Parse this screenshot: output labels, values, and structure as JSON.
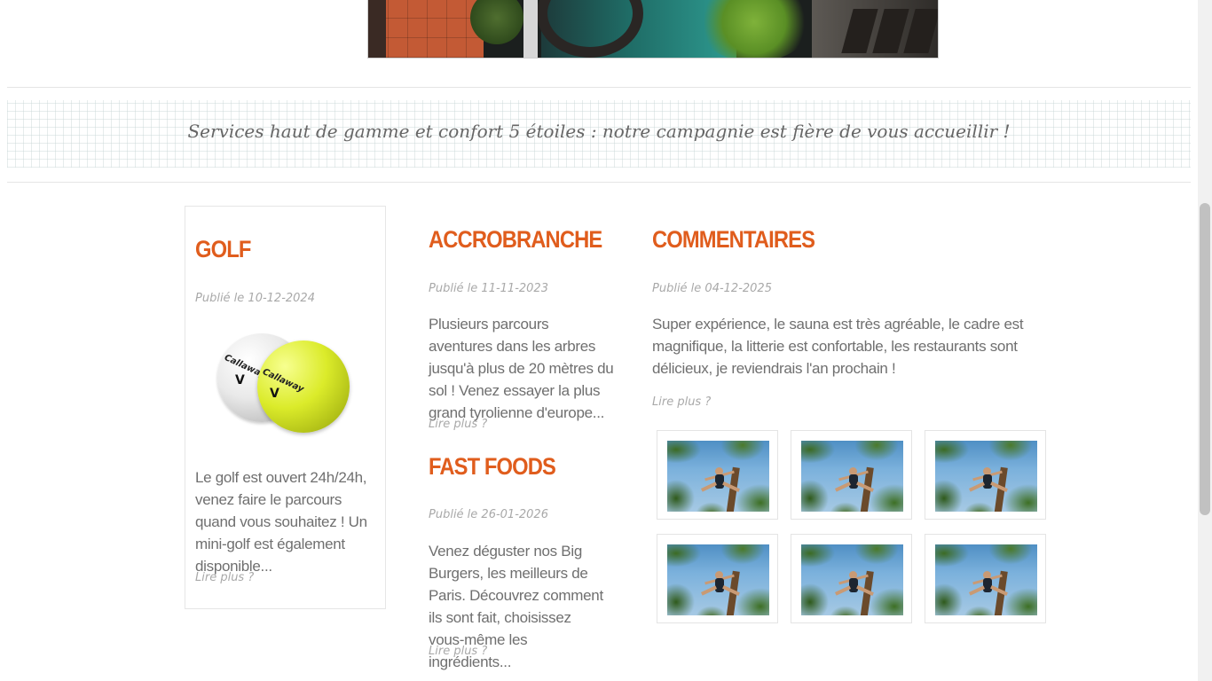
{
  "banner": {
    "tagline": "Services haut de gamme et confort 5 étoiles : notre campagnie est fière de vous accueillir !"
  },
  "articles": [
    {
      "title": "GOLF",
      "date": "Publié le 10-12-2024",
      "excerpt": "Le golf est ouvert 24h/24h, venez faire le parcours quand vous souhaitez ! Un mini-golf est également disponible...",
      "more": "Lire plus ?",
      "image": {
        "ball_logo": "Callaway"
      }
    },
    {
      "title": "ACCROBRANCHE",
      "date": "Publié le 11-11-2023",
      "excerpt": "Plusieurs parcours aventures dans les arbres jusqu'à plus de 20 mètres du sol ! Venez essayer la plus grand tyrolienne d'europe...",
      "more": "Lire plus ?"
    },
    {
      "title": "FAST FOODS",
      "date": "Publié le 26-01-2026",
      "excerpt": "Venez déguster nos Big Burgers, les meilleurs de Paris. Découvrez comment ils sont fait, choisissez vous-même les ingrédients...",
      "more": "Lire plus ?"
    },
    {
      "title": "COMMENTAIRES",
      "date": "Publié le 04-12-2025",
      "excerpt": "Super expérience, le sauna est très agréable, le cadre est magnifique, la litterie est confortable, les restaurants sont délicieux, je reviendrais l'an prochain !",
      "more": "Lire plus ?"
    }
  ],
  "gallery": {
    "count": 6,
    "image_subject": "accrobranche"
  },
  "colors": {
    "accent": "#e05d1d",
    "text": "#6f6f6f",
    "muted": "#a9a9a9"
  }
}
